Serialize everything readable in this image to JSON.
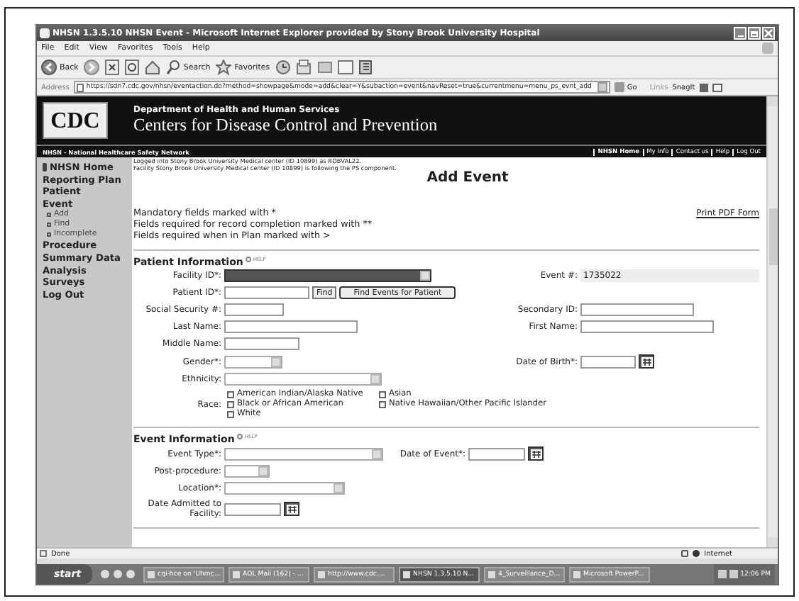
{
  "window": {
    "title": "NHSN 1.3.5.10 NHSN Event - Microsoft Internet Explorer provided by Stony Brook University Hospital"
  },
  "menu": [
    "File",
    "Edit",
    "View",
    "Favorites",
    "Tools",
    "Help"
  ],
  "toolbar": [
    {
      "kind": "back",
      "label": "Back"
    },
    {
      "kind": "forward"
    },
    {
      "kind": "stop"
    },
    {
      "kind": "refresh"
    },
    {
      "kind": "home"
    },
    {
      "kind": "search",
      "label": "Search"
    },
    {
      "kind": "favorites",
      "label": "Favorites"
    },
    {
      "kind": "history"
    },
    {
      "kind": "mail"
    },
    {
      "kind": "print"
    },
    {
      "kind": "edit"
    },
    {
      "kind": "discuss"
    }
  ],
  "address": {
    "label": "Address",
    "url": "https://sdn7.cdc.gov/nhsn/eventaction.do?method=showpage&mode=add&clear=Y&subaction=event&navReset=true&currentmenu=menu_ps_evnt_add",
    "go": "Go",
    "links": "Links",
    "snagit": "SnagIt"
  },
  "header": {
    "logo": "CDC",
    "department": "Department of Health and Human Services",
    "title": "Centers for Disease Control and Prevention"
  },
  "nav": {
    "network": "NHSN - National Healthcare Safety Network",
    "links": [
      {
        "label": "NHSN Home",
        "selected": true
      },
      {
        "label": "My Info",
        "selected": false
      },
      {
        "label": "Contact us",
        "selected": false
      },
      {
        "label": "Help",
        "selected": false
      },
      {
        "label": "Log Out",
        "selected": false
      }
    ]
  },
  "sidebar": {
    "items": [
      {
        "label": "NHSN Home",
        "kind": "home"
      },
      {
        "label": "Reporting Plan"
      },
      {
        "label": "Patient"
      },
      {
        "label": "Event",
        "children": [
          {
            "label": "Add"
          },
          {
            "label": "Find"
          },
          {
            "label": "Incomplete"
          }
        ]
      },
      {
        "label": "Procedure"
      },
      {
        "label": "Summary Data"
      },
      {
        "label": "Analysis"
      },
      {
        "label": "Surveys"
      },
      {
        "label": "Log Out"
      }
    ]
  },
  "login": [
    "Logged into Stony Brook University Medical center (ID 10899) as ROBVAL22.",
    "Facility Stony Brook University Medical center (ID 10899) is following the PS component."
  ],
  "heading": "Add Event",
  "notes": [
    "Mandatory fields marked with *",
    "Fields required for record completion marked with **",
    "Fields required when in Plan marked with >"
  ],
  "print_link": "Print PDF Form",
  "sections": [
    {
      "title": "Patient Information",
      "help": "HELP",
      "rows": [
        [
          {
            "label": "Facility ID*:",
            "kind": "select",
            "redacted": true
          },
          {
            "label": "Event #:",
            "kind": "readonly",
            "value": "1735022"
          }
        ],
        [
          {
            "label": "Patient ID*:",
            "kind": "text",
            "buttons": [
              "Find",
              "Find Events for Patient"
            ]
          }
        ],
        [
          {
            "label": "Social Security #:",
            "kind": "text"
          },
          {
            "label": "Secondary ID:",
            "kind": "text"
          }
        ],
        [
          {
            "label": "Last Name:",
            "kind": "text"
          },
          {
            "label": "First Name:",
            "kind": "text"
          }
        ],
        [
          {
            "label": "Middle Name:",
            "kind": "text"
          }
        ],
        [
          {
            "label": "Gender*:",
            "kind": "select"
          },
          {
            "label": "Date of Birth*:",
            "kind": "date"
          }
        ],
        [
          {
            "label": "Ethnicity:",
            "kind": "select"
          }
        ],
        [
          {
            "label": "Race:",
            "kind": "checks",
            "options": [
              {
                "label": "American Indian/Alaska Native",
                "checked": false
              },
              {
                "label": "Asian",
                "checked": false
              },
              {
                "label": "Black or African American",
                "checked": false
              },
              {
                "label": "Native Hawaiian/Other Pacific Islander",
                "checked": false
              },
              {
                "label": "White",
                "checked": false
              }
            ]
          }
        ]
      ]
    },
    {
      "title": "Event Information",
      "help": "HELP",
      "rows": [
        [
          {
            "label": "Event Type*:",
            "kind": "select"
          },
          {
            "label": "Date of Event*:",
            "kind": "date"
          }
        ],
        [
          {
            "label": "Post-procedure:",
            "kind": "select"
          }
        ],
        [
          {
            "label": "Location*:",
            "kind": "select"
          }
        ],
        [
          {
            "label": "Date Admitted to Facility:",
            "kind": "date"
          }
        ]
      ]
    }
  ],
  "status_bar": {
    "text": "Done",
    "zone": "Internet"
  },
  "taskbar": {
    "start": "start",
    "tasks": [
      {
        "label": "cqi-hce on 'Uhmc...",
        "selected": false
      },
      {
        "label": "AOL Mail (162) - ...",
        "selected": false
      },
      {
        "label": "http://www.cdc....",
        "selected": false
      },
      {
        "label": "NHSN 1.3.5.10 N...",
        "selected": true
      },
      {
        "label": "4_Surveillance_D...",
        "selected": false
      },
      {
        "label": "Microsoft PowerP...",
        "selected": false
      }
    ],
    "clock": "12:06 PM"
  }
}
